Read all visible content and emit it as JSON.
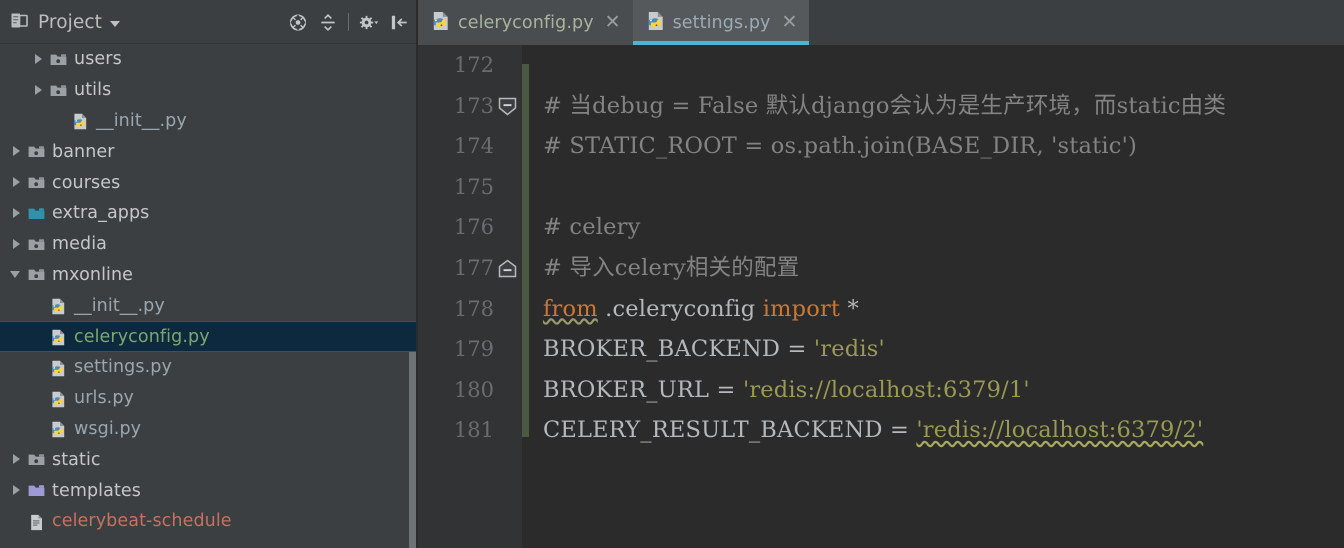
{
  "panel": {
    "title": "Project",
    "icons": [
      {
        "name": "locate-target-icon",
        "title": "Select Opened File"
      },
      {
        "name": "collapse-all-icon",
        "title": "Collapse All"
      },
      {
        "name": "gear-settings-icon",
        "title": "Settings"
      },
      {
        "name": "hide-panel-icon",
        "title": "Hide"
      }
    ],
    "tree": [
      {
        "label": "users",
        "type": "folder-gray",
        "depth": 2,
        "arrow": "collapsed",
        "selected": false
      },
      {
        "label": "utils",
        "type": "folder-gray",
        "depth": 2,
        "arrow": "collapsed",
        "selected": false
      },
      {
        "label": "__init__.py",
        "type": "python-file",
        "depth": 3,
        "arrow": "none",
        "selected": false
      },
      {
        "label": "banner",
        "type": "folder-gray",
        "depth": 1,
        "arrow": "collapsed",
        "selected": false
      },
      {
        "label": "courses",
        "type": "folder-gray",
        "depth": 1,
        "arrow": "collapsed",
        "selected": false
      },
      {
        "label": "extra_apps",
        "type": "folder-teal",
        "depth": 1,
        "arrow": "collapsed",
        "selected": false
      },
      {
        "label": "media",
        "type": "folder-gray",
        "depth": 1,
        "arrow": "collapsed",
        "selected": false
      },
      {
        "label": "mxonline",
        "type": "folder-gray",
        "depth": 1,
        "arrow": "expanded",
        "selected": false
      },
      {
        "label": "__init__.py",
        "type": "python-file",
        "depth": 2,
        "arrow": "none",
        "selected": false
      },
      {
        "label": "celeryconfig.py",
        "type": "python-file",
        "depth": 2,
        "arrow": "none",
        "selected": true
      },
      {
        "label": "settings.py",
        "type": "python-file",
        "depth": 2,
        "arrow": "none",
        "selected": false
      },
      {
        "label": "urls.py",
        "type": "python-file",
        "depth": 2,
        "arrow": "none",
        "selected": false
      },
      {
        "label": "wsgi.py",
        "type": "python-file",
        "depth": 2,
        "arrow": "none",
        "selected": false
      },
      {
        "label": "static",
        "type": "folder-gray",
        "depth": 1,
        "arrow": "collapsed",
        "selected": false
      },
      {
        "label": "templates",
        "type": "folder-purple",
        "depth": 1,
        "arrow": "collapsed",
        "selected": false
      },
      {
        "label": "celerybeat-schedule",
        "type": "text-file",
        "depth": 1,
        "arrow": "none",
        "selected": false
      }
    ]
  },
  "editor": {
    "tabs": [
      {
        "label": "celeryconfig.py",
        "active": false,
        "close": "✕"
      },
      {
        "label": "settings.py",
        "active": true,
        "close": "✕"
      }
    ],
    "first_line_number": 172,
    "lines": [
      {
        "num": "172",
        "fold": "none",
        "tokens": []
      },
      {
        "num": "173",
        "fold": "collapse",
        "tokens": [
          {
            "t": "# 当debug = False 默认django会认为是生产环境，而static由类",
            "c": "c-comment"
          }
        ]
      },
      {
        "num": "174",
        "fold": "none",
        "tokens": [
          {
            "t": "# STATIC_ROOT = os.path.join(BASE_DIR, 'static')",
            "c": "c-comment"
          }
        ]
      },
      {
        "num": "175",
        "fold": "none",
        "tokens": []
      },
      {
        "num": "176",
        "fold": "none",
        "tokens": [
          {
            "t": "# celery",
            "c": "c-comment"
          }
        ]
      },
      {
        "num": "177",
        "fold": "expand",
        "tokens": [
          {
            "t": "# 导入celery相关的配置",
            "c": "c-comment"
          }
        ]
      },
      {
        "num": "178",
        "fold": "none",
        "tokens": [
          {
            "t": "from",
            "c": "c-kw",
            "wavy": true
          },
          {
            "t": " .celeryconfig ",
            "c": "c-plain"
          },
          {
            "t": "import",
            "c": "c-kw"
          },
          {
            "t": " *",
            "c": "c-plain"
          }
        ]
      },
      {
        "num": "179",
        "fold": "none",
        "tokens": [
          {
            "t": "BROKER_BACKEND = ",
            "c": "c-plain"
          },
          {
            "t": "'redis'",
            "c": "c-str"
          }
        ]
      },
      {
        "num": "180",
        "fold": "none",
        "tokens": [
          {
            "t": "BROKER_URL = ",
            "c": "c-plain"
          },
          {
            "t": "'redis://localhost:6379/1'",
            "c": "c-str"
          }
        ]
      },
      {
        "num": "181",
        "fold": "none",
        "tokens": [
          {
            "t": "CELERY_RESULT_BACKEND = ",
            "c": "c-plain"
          },
          {
            "t": "'redis://localhost:6379/2'",
            "c": "c-str",
            "wavy": true
          }
        ]
      }
    ]
  },
  "colors": {
    "panel_bg": "#3c3f41",
    "editor_bg": "#2b2b2b",
    "gutter_bg": "#313335",
    "selection_bg": "#0d293e",
    "active_tab_accent": "#4eb4cf",
    "change_bar": "#4a5a41",
    "keyword": "#cc7832",
    "string": "#9a9a54",
    "comment": "#838383",
    "identifier": "#b4b9bd"
  }
}
